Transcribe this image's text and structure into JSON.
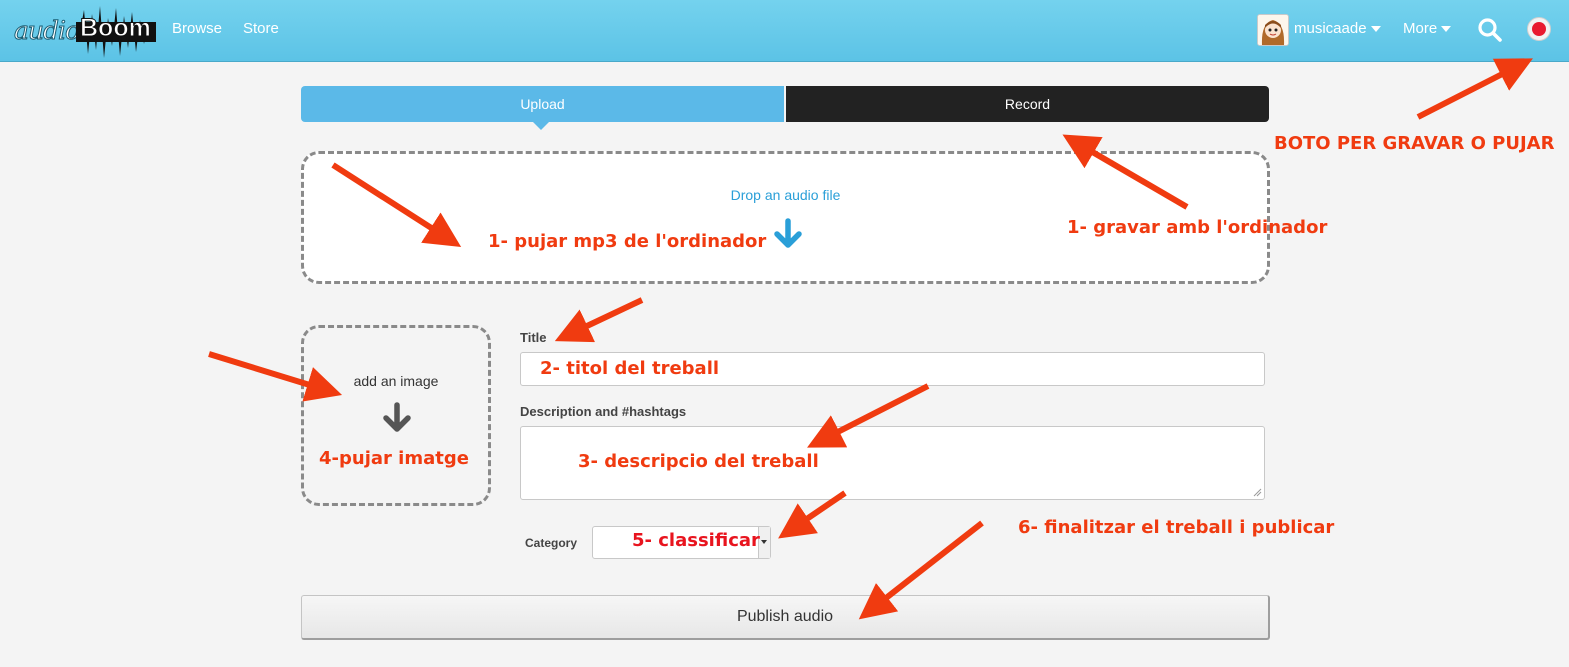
{
  "header": {
    "logo_text_audio": "audio",
    "logo_text_boom": "Boom",
    "nav": [
      {
        "label": "Browse"
      },
      {
        "label": "Store"
      }
    ],
    "user": {
      "name": "musicaade"
    },
    "more_label": "More",
    "icons": {
      "search": "search-icon",
      "record": "record-icon",
      "avatar": "avatar-icon"
    }
  },
  "tabs": [
    {
      "label": "Upload",
      "active": true
    },
    {
      "label": "Record",
      "active": false
    }
  ],
  "dropzone": {
    "label": "Drop an audio file",
    "icon": "arrow-down-icon"
  },
  "image_zone": {
    "label": "add an image",
    "icon": "arrow-down-icon"
  },
  "form": {
    "title_label": "Title",
    "title_value": "",
    "description_label": "Description and #hashtags",
    "description_value": "",
    "category_label": "Category",
    "category_value": ""
  },
  "publish_label": "Publish audio",
  "annotations": [
    {
      "text": "BOTO PER GRAVAR O PUJAR"
    },
    {
      "text": "1- pujar mp3 de l'ordinador"
    },
    {
      "text": "1- gravar amb l'ordinador"
    },
    {
      "text": "2- titol del treball"
    },
    {
      "text": "3- descripcio del treball"
    },
    {
      "text": "4-pujar imatge"
    },
    {
      "text": "5- classificar"
    },
    {
      "text": "6- finalitzar el treball i publicar"
    }
  ],
  "colors": {
    "header_bg": "#66cbeb",
    "tab_active": "#5bb9e8",
    "tab_inactive": "#222222",
    "link_blue": "#2a9fd8",
    "annotation": "#f03b10",
    "record_red": "#e8192f"
  }
}
